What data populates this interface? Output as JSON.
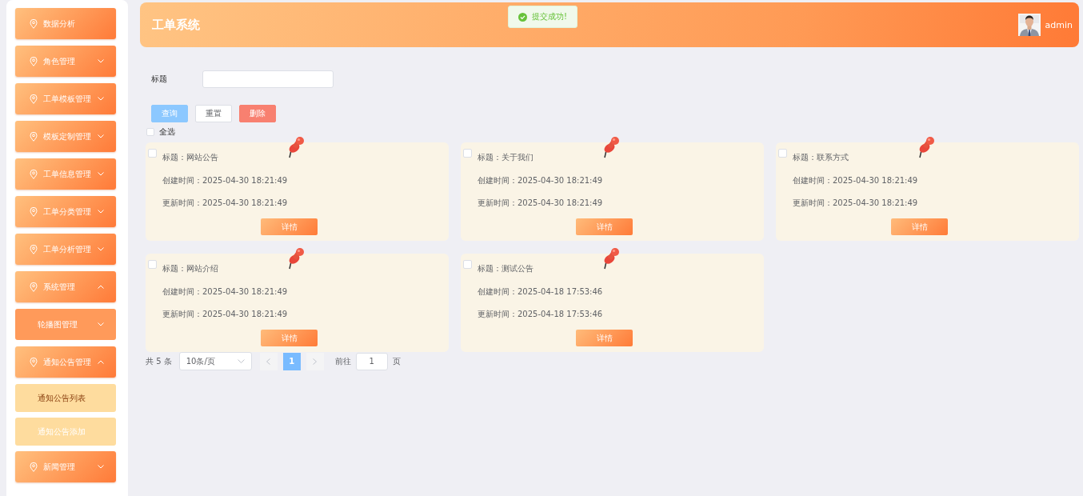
{
  "sidebar": {
    "items": [
      {
        "kind": "menu",
        "label": "数据分析"
      },
      {
        "kind": "menu",
        "label": "角色管理",
        "expanded": false
      },
      {
        "kind": "menu",
        "label": "工单模板管理",
        "expanded": false
      },
      {
        "kind": "menu",
        "label": "模板定制管理",
        "expanded": false
      },
      {
        "kind": "menu",
        "label": "工单信息管理",
        "expanded": false
      },
      {
        "kind": "menu",
        "label": "工单分类管理",
        "expanded": false
      },
      {
        "kind": "menu",
        "label": "工单分析管理",
        "expanded": false
      },
      {
        "kind": "menu",
        "label": "系统管理",
        "expanded": true,
        "children": [
          {
            "kind": "submenu",
            "label": "轮播图管理",
            "expanded": false
          },
          {
            "kind": "menu",
            "label": "通知公告管理",
            "expanded": true,
            "children": [
              {
                "kind": "leaf",
                "label": "通知公告列表",
                "selected": true
              },
              {
                "kind": "leaf",
                "label": "通知公告添加",
                "selected": false
              }
            ]
          }
        ]
      },
      {
        "kind": "menu",
        "label": "新闻管理",
        "expanded": false
      }
    ]
  },
  "header": {
    "title": "工单系统",
    "toast": "提交成功!",
    "user": "admin"
  },
  "search": {
    "label": "标题"
  },
  "buttons": [
    {
      "label": "查询",
      "kind": "primary"
    },
    {
      "label": "重置",
      "kind": "default"
    },
    {
      "label": "删除",
      "kind": "danger"
    }
  ],
  "select_all": {
    "label": "全选",
    "checked": false
  },
  "cards": [
    {
      "checked": false,
      "lines": [
        "标题：网站公告",
        "创建时间：2025-04-30 18:21:49",
        "更新时间：2025-04-30 18:21:49"
      ],
      "button": "详情"
    },
    {
      "checked": false,
      "lines": [
        "标题：关于我们",
        "创建时间：2025-04-30 18:21:49",
        "更新时间：2025-04-30 18:21:49"
      ],
      "button": "详情"
    },
    {
      "checked": false,
      "lines": [
        "标题：联系方式",
        "创建时间：2025-04-30 18:21:49",
        "更新时间：2025-04-30 18:21:49"
      ],
      "button": "详情"
    },
    {
      "checked": false,
      "lines": [
        "标题：网站介绍",
        "创建时间：2025-04-30 18:21:49",
        "更新时间：2025-04-30 18:21:49"
      ],
      "button": "详情"
    },
    {
      "checked": false,
      "lines": [
        "标题：测试公告",
        "创建时间：2025-04-18 17:53:46",
        "更新时间：2025-04-18 17:53:46"
      ],
      "button": "详情"
    }
  ],
  "pagination": {
    "total": "共 5 条",
    "page_size": "10条/页",
    "pages": [
      {
        "label": "1",
        "selected": true
      }
    ],
    "goto_label": "前往",
    "goto_value": "1",
    "goto_suffix": "页"
  }
}
